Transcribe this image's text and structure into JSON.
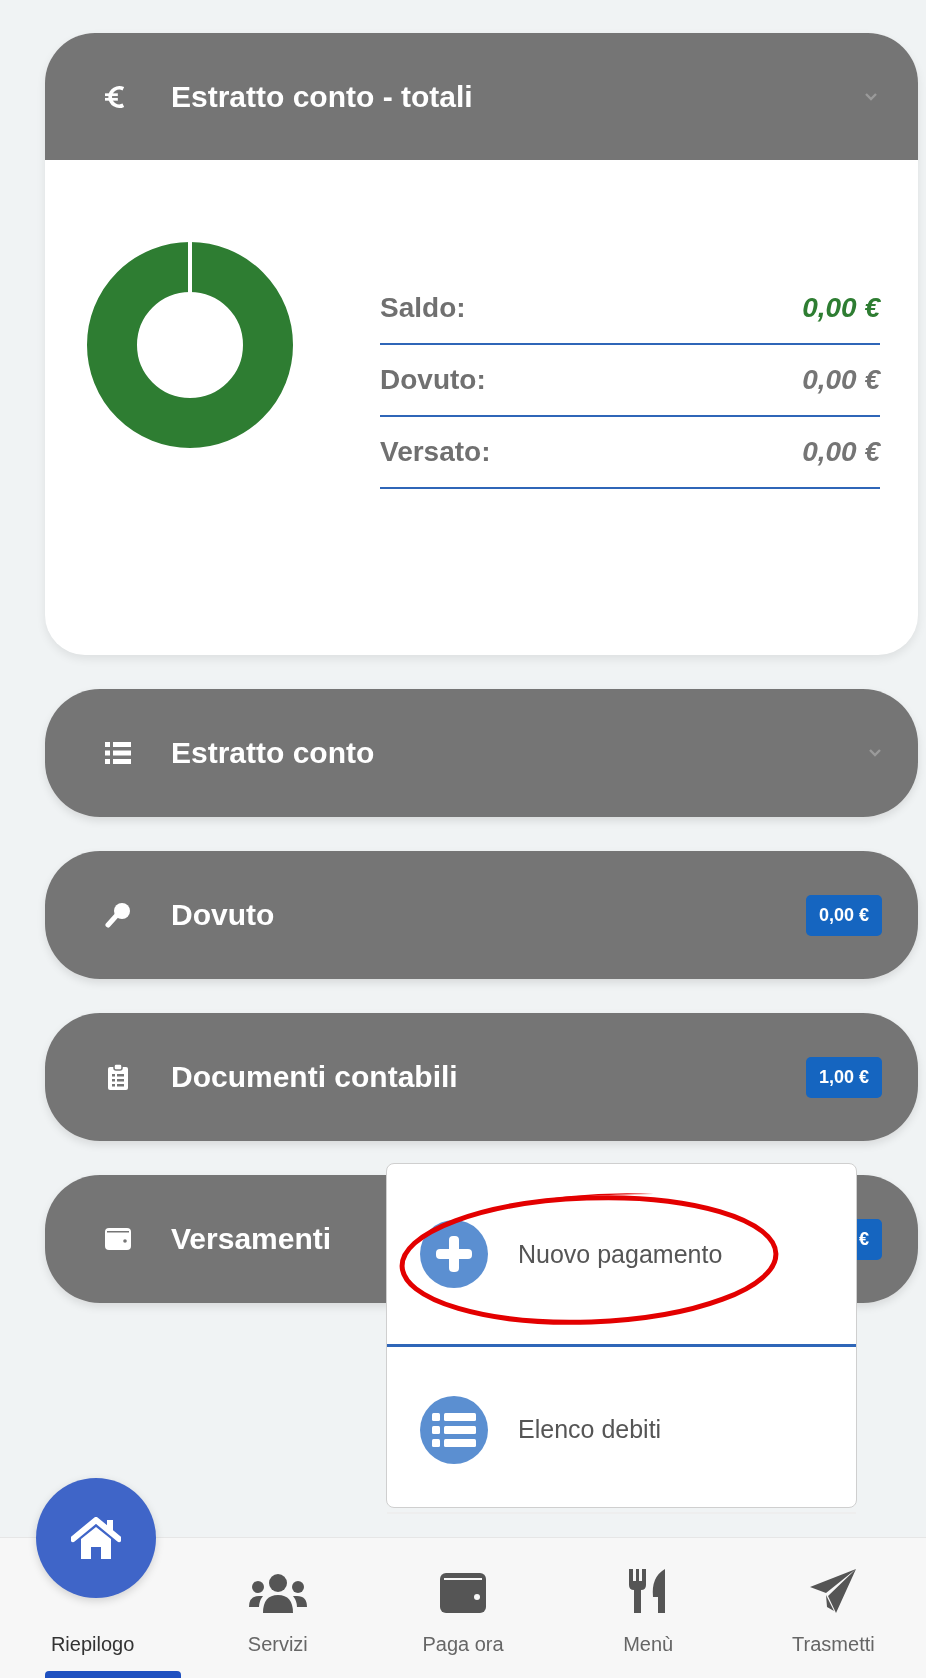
{
  "summary_card": {
    "title": "Estratto conto - totali",
    "expanded": true,
    "rows": [
      {
        "label": "Saldo:",
        "value": "0,00 €",
        "color": "#2e7d32"
      },
      {
        "label": "Dovuto:",
        "value": "0,00 €",
        "color": "#757575"
      },
      {
        "label": "Versato:",
        "value": "0,00 €",
        "color": "#757575"
      }
    ]
  },
  "panels": [
    {
      "title": "Estratto conto",
      "kind": "collapsible"
    },
    {
      "title": "Dovuto",
      "kind": "badge",
      "badge": "0,00 €"
    },
    {
      "title": "Documenti contabili",
      "kind": "badge",
      "badge": "1,00 €"
    },
    {
      "title": "Versamenti",
      "kind": "badge",
      "badge": "€"
    }
  ],
  "popup_menu": {
    "items": [
      {
        "label": "Nuovo pagamento",
        "highlighted": true
      },
      {
        "label": "Elenco debiti",
        "highlighted": false
      }
    ]
  },
  "bottom_nav": [
    {
      "label": "Riepilogo",
      "selected": true
    },
    {
      "label": "Servizi",
      "selected": false
    },
    {
      "label": "Paga ora",
      "selected": false
    },
    {
      "label": "Menù",
      "selected": false
    },
    {
      "label": "Trasmetti",
      "selected": false
    }
  ]
}
